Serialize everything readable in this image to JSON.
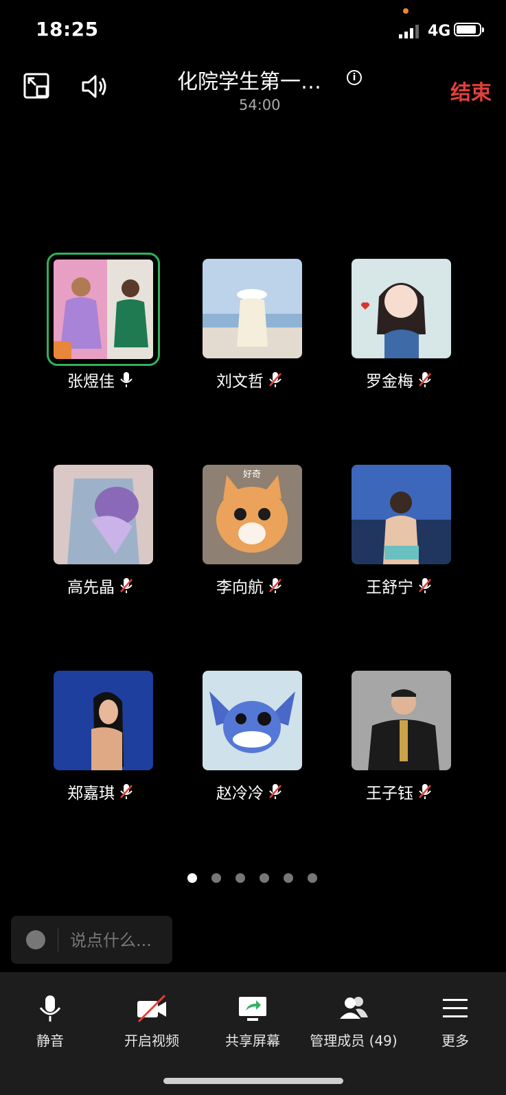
{
  "status": {
    "time": "18:25",
    "network": "4G"
  },
  "header": {
    "title": "化院学生第一…",
    "duration": "54:00",
    "end_label": "结束"
  },
  "participants": [
    {
      "name": "张煜佳",
      "mic": "on"
    },
    {
      "name": "刘文哲",
      "mic": "muted"
    },
    {
      "name": "罗金梅",
      "mic": "muted"
    },
    {
      "name": "高先晶",
      "mic": "muted"
    },
    {
      "name": "李向航",
      "mic": "muted"
    },
    {
      "name": "王舒宁",
      "mic": "muted"
    },
    {
      "name": "郑嘉琪",
      "mic": "muted"
    },
    {
      "name": "赵冷冷",
      "mic": "muted"
    },
    {
      "name": "王子钰",
      "mic": "muted"
    }
  ],
  "tile_overlay_text": "好奇",
  "pagination": {
    "pages": 6,
    "current": 1
  },
  "chat": {
    "placeholder": "说点什么..."
  },
  "toolbar": {
    "mute": "静音",
    "video": "开启视频",
    "share": "共享屏幕",
    "members": "管理成员 (49)",
    "more": "更多"
  },
  "colors": {
    "end": "#e5403a",
    "active_speaker": "#2fb35f",
    "host_badge": "#e8863a",
    "share_icon": "#2fb35f"
  }
}
